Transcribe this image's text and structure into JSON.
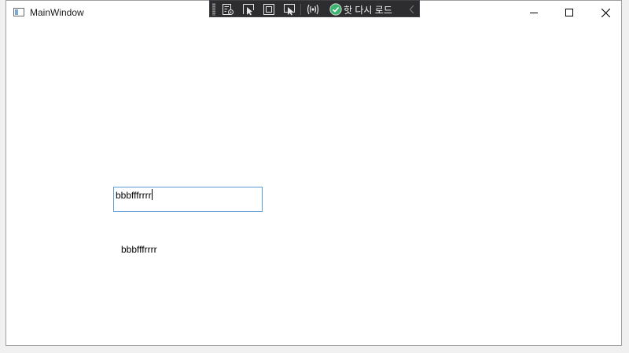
{
  "window": {
    "title": "MainWindow",
    "icon": "window-app-icon"
  },
  "caption_buttons": {
    "minimize_icon": "minimize-icon",
    "maximize_icon": "maximize-icon",
    "close_icon": "close-icon"
  },
  "debug_toolbar": {
    "tools": [
      "live-visual-tree-icon",
      "select-element-icon",
      "display-layout-adorners-icon",
      "track-focus-icon",
      "binding-failures-icon"
    ],
    "hot_reload": {
      "icon": "check-circle-icon",
      "label": "핫 다시 로드",
      "status_color": "#3cb371"
    },
    "collapse_icon": "chevron-left-icon"
  },
  "content": {
    "input_value": "bbbfffrrrr",
    "label_text": "bbbfffrrrr"
  },
  "colors": {
    "input_border_focus": "#5a9bd8",
    "toolbar_background": "#2d2d30"
  }
}
